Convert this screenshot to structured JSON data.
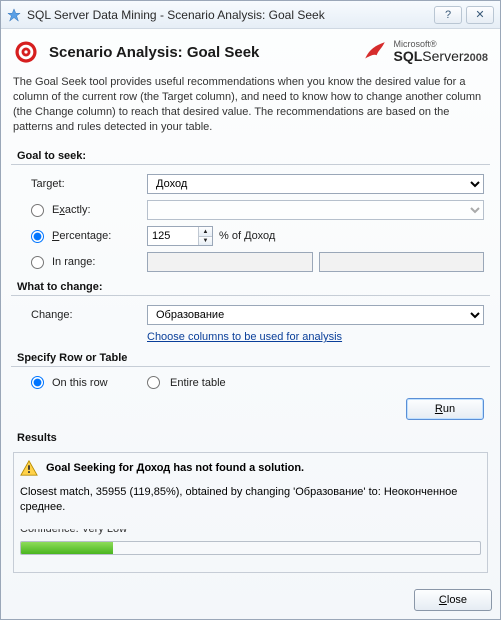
{
  "window": {
    "title": "SQL Server Data Mining - Scenario Analysis: Goal Seek"
  },
  "titlebar_buttons": {
    "help": "?",
    "close": "✕"
  },
  "header": {
    "title": "Scenario Analysis: Goal Seek",
    "logo_ms": "Microsoft®",
    "logo_sql": "SQL",
    "logo_server": "Server",
    "logo_year": "2008"
  },
  "description": "The Goal Seek tool provides useful recommendations when you know the desired value for a column of the current row (the Target column), and need to know how to change another column (the Change column) to reach that desired value. The recommendations are based on the patterns and rules detected in your table.",
  "goal": {
    "section": "Goal to seek:",
    "target_label": "Target:",
    "target_value": "Доход",
    "exactly_label_pre": "E",
    "exactly_label_u": "x",
    "exactly_label_post": "actly:",
    "exactly_value": "",
    "percentage_label_u": "P",
    "percentage_label_post": "ercentage:",
    "percentage_value": "125",
    "percentage_suffix": "% of Доход",
    "inrange_label": "In range:",
    "inrange_from": "",
    "inrange_to": ""
  },
  "change": {
    "section": "What to change:",
    "label": "Change:",
    "value": "Образование",
    "link": "Choose columns to be used for analysis"
  },
  "scope": {
    "section": "Specify Row or Table",
    "thisrow": "On this row",
    "entire": "Entire table"
  },
  "buttons": {
    "run_u": "R",
    "run_post": "un",
    "close_u": "C",
    "close_post": "lose"
  },
  "results": {
    "section": "Results",
    "title_pre": "Goal Seeking for ",
    "title_target": "Доход",
    "title_post": " has not found a solution.",
    "body": "Closest match, 35955 (119,85%), obtained by changing 'Образование' to: Неоконченное среднее.",
    "confidence_label": "Confidence: Very Low",
    "progress_percent": 20
  }
}
